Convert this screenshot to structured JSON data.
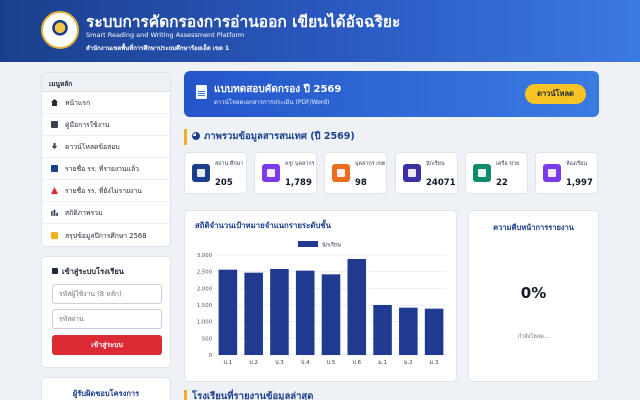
{
  "header": {
    "title": "ระบบการคัดกรองการอ่านออก เขียนได้อัจฉริยะ",
    "subtitle": "Smart Reading and Writing Assessment Platform",
    "org": "สำนักงานเขตพื้นที่การศึกษาประถมศึกษาร้อยเอ็ด เขต 1",
    "logo": "seal-logo"
  },
  "sidebar": {
    "menu_title": "เมนูหลัก",
    "items": [
      {
        "label": "หน้าแรก",
        "icon": "home-icon",
        "color": "#1f2937"
      },
      {
        "label": "คู่มือการใช้งาน",
        "icon": "book-icon",
        "color": "#374151"
      },
      {
        "label": "ดาวน์โหลดข้อสอบ",
        "icon": "download-icon",
        "color": "#374151"
      },
      {
        "label": "รายชื่อ รร. ที่รายงานแล้ว",
        "icon": "check-list-icon",
        "color": "#1b3f8c"
      },
      {
        "label": "รายชื่อ รร. ที่ยังไม่รายงาน",
        "icon": "warning-icon",
        "color": "#dc2b35"
      },
      {
        "label": "สถิติภาพรวม",
        "icon": "stats-icon",
        "color": "#374151"
      },
      {
        "label": "สรุปข้อมูลปีการศึกษา 2568",
        "icon": "summary-icon",
        "color": "#f2b01e"
      }
    ],
    "login": {
      "title": "เข้าสู่ระบบโรงเรียน",
      "school_code_placeholder": "รหัสผู้ใช้งาน (8 หลัก)",
      "password_placeholder": "รหัสผ่าน",
      "submit_label": "เข้าสู่ระบบ"
    },
    "responsible_title": "ผู้รับผิดชอบโครงการ"
  },
  "banner": {
    "title": "แบบทดสอบคัดกรอง ปี 2569",
    "subtitle": "ดาวน์โหลดเอกสารการประเมิน (PDF/Word)",
    "button": "ดาวน์โหลด"
  },
  "overview": {
    "title": "ภาพรวมข้อมูลสารสนเทศ (ปี 2569)",
    "stats": [
      {
        "label": "สถาน ศึกษา",
        "value": "205",
        "icon": "school-icon",
        "color": "#1b3f8c"
      },
      {
        "label": "ครู/ บุคลากร",
        "value": "1,789",
        "icon": "teacher-icon",
        "color": "#7c3aed"
      },
      {
        "label": "บุคลากร เขต",
        "value": "98",
        "icon": "staff-icon",
        "color": "#ea6c1d"
      },
      {
        "label": "นักเรียน",
        "value": "24071",
        "icon": "student-icon",
        "color": "#3b2fa6"
      },
      {
        "label": "เครือ ข่าย",
        "value": "22",
        "icon": "network-icon",
        "color": "#0f8a6c"
      },
      {
        "label": "ห้องเรียน",
        "value": "1,997",
        "icon": "classroom-icon",
        "color": "#7c3aed"
      }
    ]
  },
  "chart_data": {
    "type": "bar",
    "title": "สถิติจำนวนเป้าหมายจำแนกรายระดับชั้น",
    "categories": [
      "ป.1",
      "ป.2",
      "ป.3",
      "ป.4",
      "ป.5",
      "ป.6",
      "ม.1",
      "ม.2",
      "ม.3"
    ],
    "series": [
      {
        "name": "นักเรียน",
        "values": [
          2560,
          2470,
          2580,
          2530,
          2420,
          2880,
          1500,
          1420,
          1390
        ],
        "color": "#1f3a8f"
      }
    ],
    "ylim": [
      0,
      3000
    ],
    "yticks": [
      "0",
      "500",
      "1,000",
      "1,500",
      "2,000",
      "2,500",
      "3,000"
    ],
    "legend": "top-center",
    "grid": true
  },
  "progress": {
    "title": "ความคืบหน้าการรายงาน",
    "value": "0%",
    "status": "กำลังโหลด..."
  },
  "bottom_section": {
    "title": "โรงเรียนที่รายงานข้อมูลล่าสุด"
  }
}
